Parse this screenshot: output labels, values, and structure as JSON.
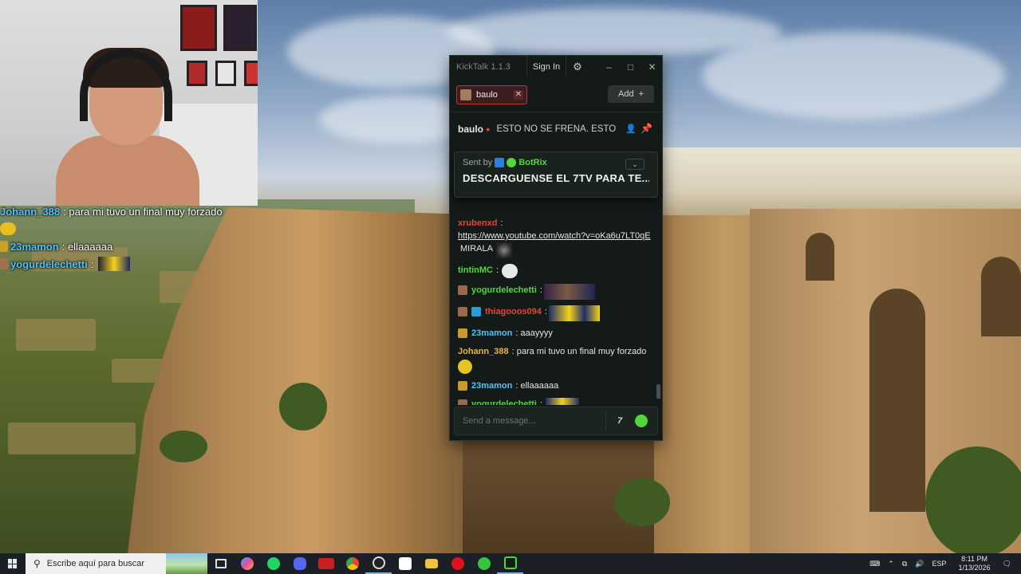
{
  "overlay_chat": [
    {
      "user": "Johann_388",
      "text": "para mi tuvo un final muy forzado"
    },
    {
      "user": "23mamon",
      "text": "ellaaaaaa"
    },
    {
      "user": "yogurdelechetti",
      "text": ""
    }
  ],
  "kicktalk": {
    "title": "KickTalk 1.1.3",
    "sign_in": "Sign In",
    "tab": {
      "label": "baulo"
    },
    "add_button": "Add",
    "stream": {
      "streamer": "baulo",
      "title": "ESTO NO SE FRENA. ESTO..."
    },
    "pinned": {
      "sent_by_label": "Sent by",
      "bot": "BotRix",
      "text": "DESCARGUENSE EL 7TV PARA TE..."
    },
    "messages": [
      {
        "user": "xrubenxd",
        "color": "#e8443a",
        "link": "https://www.youtube.com/watch?v=oKa6u7LT0qE",
        "text": "MIRALA",
        "badges": []
      },
      {
        "user": "tintinMC",
        "color": "#53d63b",
        "text": "",
        "badges": []
      },
      {
        "user": "yogurdelechetti",
        "color": "#53d63b",
        "text": "",
        "badges": [
          "sub"
        ]
      },
      {
        "user": "thiagooos094",
        "color": "#e8443a",
        "text": "",
        "badges": [
          "sub",
          "gift"
        ]
      },
      {
        "user": "23mamon",
        "color": "#4fc3f7",
        "text": "aaayyyy",
        "badges": [
          "gold"
        ]
      },
      {
        "user": "Johann_388",
        "color": "#e6b53c",
        "text": "para mi tuvo un final muy forzado",
        "badges": []
      },
      {
        "user": "23mamon",
        "color": "#4fc3f7",
        "text": "ellaaaaaa",
        "badges": [
          "gold"
        ]
      },
      {
        "user": "yogurdelechetti",
        "color": "#53d63b",
        "text": "",
        "badges": [
          "sub"
        ]
      }
    ],
    "input_placeholder": "Send a message..."
  },
  "taskbar": {
    "search_placeholder": "Escribe aquí para buscar",
    "language": "ESP",
    "time": "8:11 PM",
    "date": "1/13/2026"
  },
  "colors": {
    "kick_green": "#53d63b",
    "tab_red": "#b03a3a",
    "window_bg": "#141a17"
  }
}
